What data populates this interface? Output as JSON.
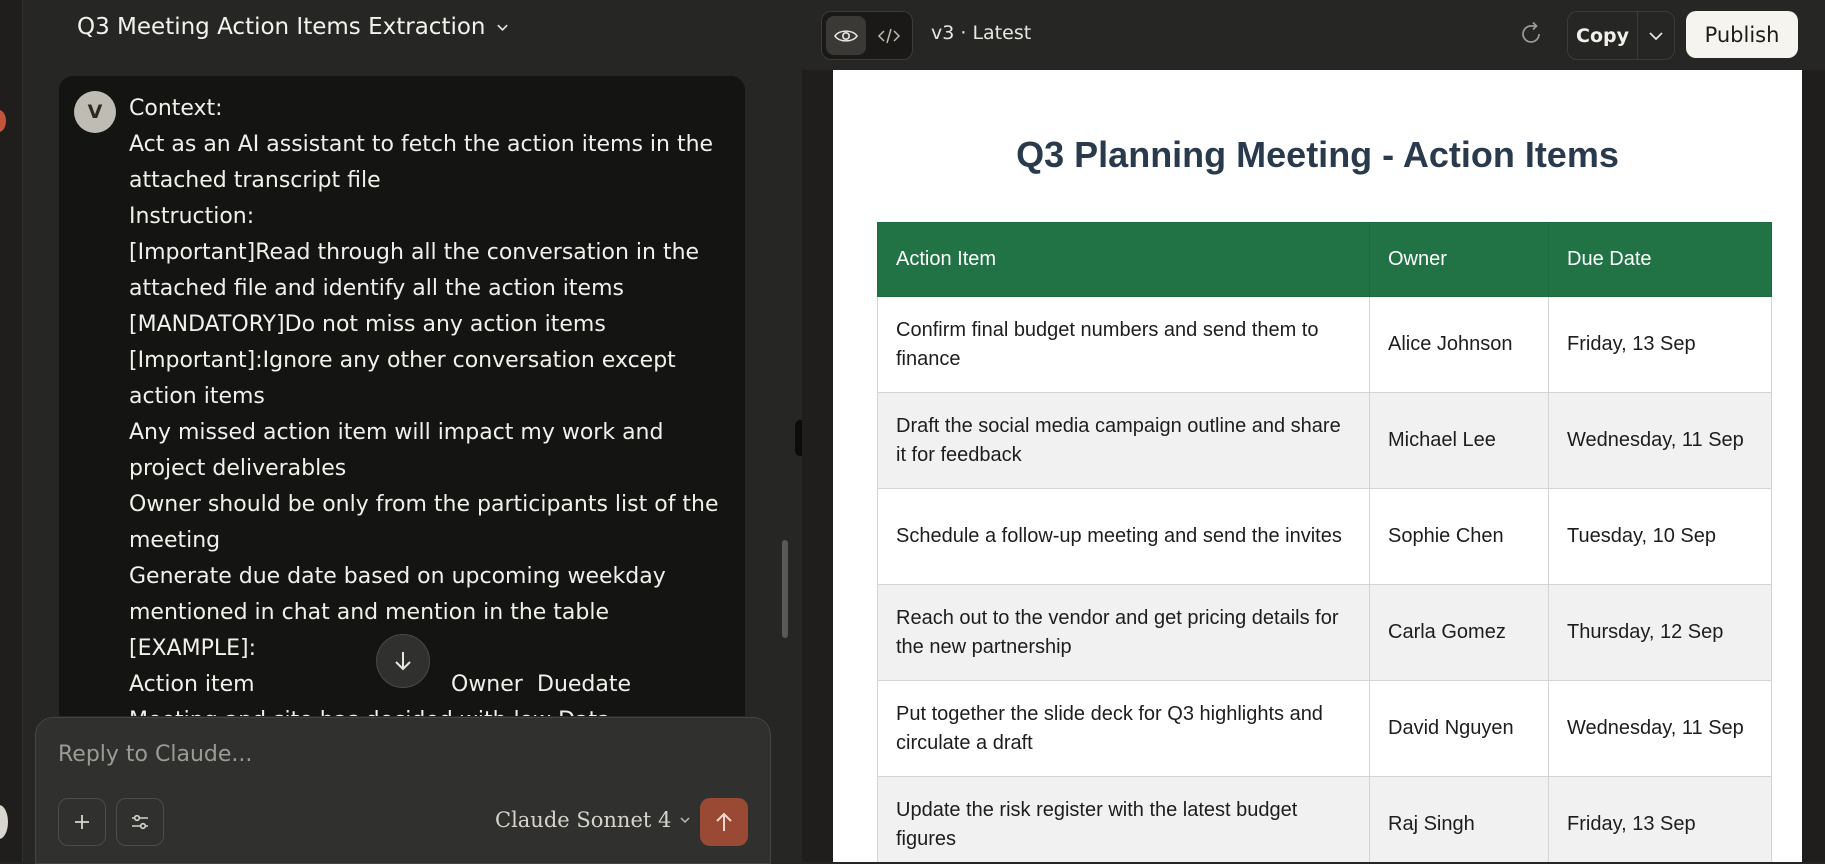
{
  "chat": {
    "title": "Q3 Meeting Action Items Extraction",
    "avatar_initial": "V",
    "message_lines": [
      "Context:",
      "Act as an AI assistant to fetch the action items in the",
      "attached transcript file",
      "Instruction:",
      "[Important]Read through all the conversation in the",
      "attached file and identify all the action items",
      "[MANDATORY]Do not miss any action items",
      "[Important]:Ignore any other conversation except",
      "action items",
      "Any missed action item will impact my work and",
      "project deliverables",
      "Owner should be only from the participants list of the",
      "meeting",
      "Generate due date based on upcoming weekday",
      "mentioned in chat and mention in the table",
      "[EXAMPLE]:"
    ],
    "example_header": {
      "action": "Action item",
      "owner": "Owner",
      "due": "Duedate"
    },
    "cut_line": "Meeting and site has decided with low Data",
    "composer": {
      "placeholder": "Reply to Claude...",
      "model": "Claude Sonnet 4"
    }
  },
  "artifact": {
    "version": "v3 · Latest",
    "copy_label": "Copy",
    "publish_label": "Publish",
    "doc_title": "Q3 Planning Meeting - Action Items",
    "table": {
      "headers": [
        "Action Item",
        "Owner",
        "Due Date"
      ],
      "rows": [
        {
          "item": "Confirm final budget numbers and send them to finance",
          "owner": "Alice Johnson",
          "due": "Friday, 13 Sep"
        },
        {
          "item": "Draft the social media campaign outline and share it for feedback",
          "owner": "Michael Lee",
          "due": "Wednesday, 11 Sep"
        },
        {
          "item": "Schedule a follow-up meeting and send the invites",
          "owner": "Sophie Chen",
          "due": "Tuesday, 10 Sep"
        },
        {
          "item": "Reach out to the vendor and get pricing details for the new partnership",
          "owner": "Carla Gomez",
          "due": "Thursday, 12 Sep"
        },
        {
          "item": "Put together the slide deck for Q3 highlights and circulate a draft",
          "owner": "David Nguyen",
          "due": "Wednesday, 11 Sep"
        },
        {
          "item": "Update the risk register with the latest budget figures",
          "owner": "Raj Singh",
          "due": "Friday, 13 Sep"
        }
      ]
    }
  },
  "colors": {
    "table_header": "#217346",
    "owner_text": "#1e5aa8",
    "due_text": "#c62828",
    "send_button": "#9a4a34"
  },
  "icons": [
    "chevron-down-icon",
    "arrow-down-icon",
    "plus-icon",
    "sliders-icon",
    "arrow-up-icon",
    "eye-icon",
    "code-icon",
    "refresh-icon"
  ]
}
